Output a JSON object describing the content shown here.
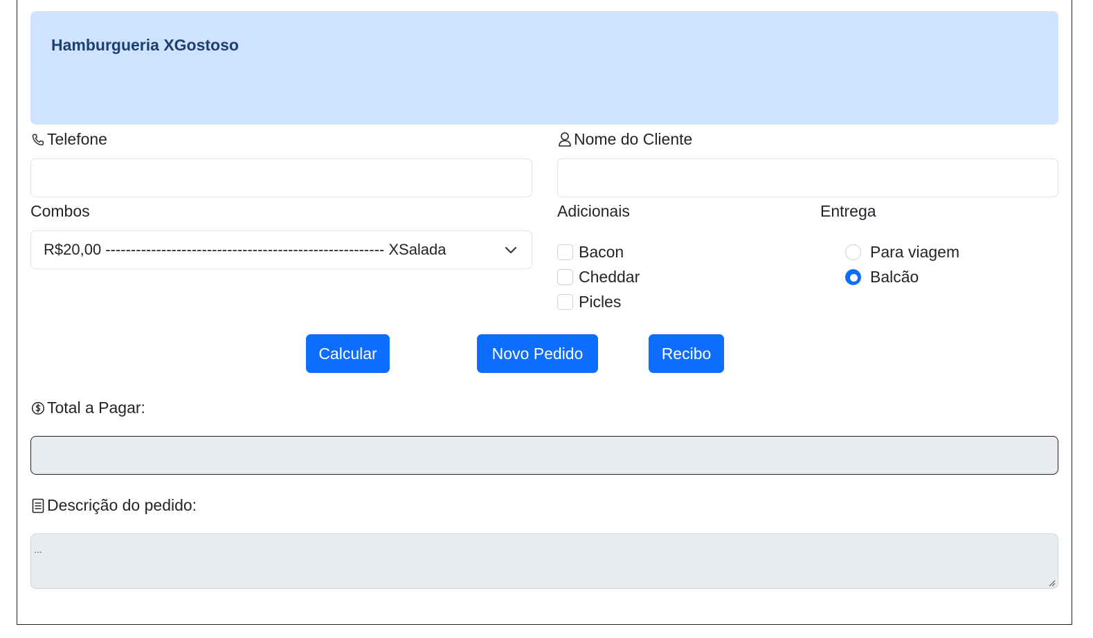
{
  "header": {
    "title": "Hamburgueria XGostoso"
  },
  "form": {
    "phone": {
      "label": "Telefone",
      "value": ""
    },
    "client_name": {
      "label": "Nome do Cliente",
      "value": ""
    },
    "combos": {
      "label": "Combos",
      "selected": "R$20,00 ------------------------------------------------------- XSalada"
    },
    "extras": {
      "label": "Adicionais",
      "options": [
        {
          "label": "Bacon",
          "checked": false
        },
        {
          "label": "Cheddar",
          "checked": false
        },
        {
          "label": "Picles",
          "checked": false
        }
      ]
    },
    "delivery": {
      "label": "Entrega",
      "options": [
        {
          "label": "Para viagem",
          "checked": false
        },
        {
          "label": "Balcão",
          "checked": true
        }
      ]
    }
  },
  "buttons": {
    "calculate": "Calcular",
    "new_order": "Novo Pedido",
    "receipt": "Recibo"
  },
  "total": {
    "label": "Total a Pagar:",
    "value": ""
  },
  "description": {
    "label": "Descrição do pedido:",
    "placeholder": "..."
  },
  "colors": {
    "primary": "#0d6efd",
    "banner_bg": "#cfe2ff",
    "banner_text": "#1b3f6f",
    "readonly_bg": "#e9ecef"
  }
}
